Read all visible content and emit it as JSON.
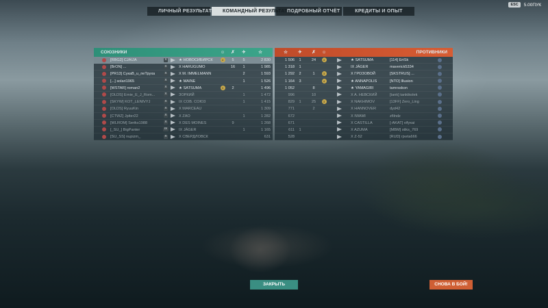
{
  "tabs": [
    {
      "label": "ЛИЧНЫЙ РЕЗУЛЬТАТ",
      "active": false
    },
    {
      "label": "КОМАНДНЫЙ РЕЗУЛЬТАТ",
      "active": true
    },
    {
      "label": "ПОДРОБНЫЙ ОТЧЁТ",
      "active": false
    },
    {
      "label": "КРЕДИТЫ И ОПЫТ",
      "active": false
    }
  ],
  "topbar": {
    "esc": "ESC",
    "version": "5.00ПУК"
  },
  "allies": {
    "title": "СОЮЗНИКИ",
    "accent": "#3ca58a",
    "rows": [
      {
        "player": "[RBG2] CJAIJA",
        "tier": "X",
        "ship": "★ НОВОСИБИРСК",
        "ace": "4",
        "kills": "5",
        "planes": "5",
        "xp": "2 830",
        "self": true
      },
      {
        "player": "[BrON] ...",
        "tier": "X",
        "ship": "X HARUGUMO",
        "ace": "",
        "kills": "16",
        "planes": "1",
        "xp": "1 985"
      },
      {
        "player": "[PR13] СукаВ_u_пеТруха",
        "tier": "X",
        "ship": "X M. IMMELMANN",
        "ace": "",
        "kills": "",
        "planes": "2",
        "xp": "1 593"
      },
      {
        "player": "[...] solari1965",
        "tier": "X",
        "ship": "★ MAINE",
        "ace": "",
        "kills": "",
        "planes": "1",
        "xp": "1 526"
      },
      {
        "player": "[WSTAR] roman2",
        "tier": "X",
        "ship": "★ SATSUMA",
        "ace": "3",
        "kills": "2",
        "planes": "",
        "xp": "1 496"
      },
      {
        "player": "[OLDS] Ernie_E_J_Rom...",
        "tier": "X",
        "ship": "ЗОРКИЙ",
        "ace": "",
        "kills": "",
        "planes": "1",
        "xp": "1 472"
      },
      {
        "player": "[SKYW] KOT_LENIVYJ",
        "tier": "X",
        "ship": "IX COB. COЮ3",
        "ace": "",
        "kills": "",
        "planes": "1",
        "xp": "1 415"
      },
      {
        "player": "[OLDS] RyuuKin",
        "tier": "X",
        "ship": "X MARCEAU",
        "ace": "",
        "kills": "",
        "planes": "",
        "xp": "1 309"
      },
      {
        "player": "[CTWZ] Jpiter22",
        "tier": "X",
        "ship": "X ZAO",
        "ace": "",
        "kills": "",
        "planes": "1",
        "xp": "1 282"
      },
      {
        "player": "[WLROM] Seriks1988",
        "tier": "X",
        "ship": "X DES MOINES",
        "ace": "",
        "kills": "9",
        "planes": "",
        "xp": "1 268"
      },
      {
        "player": "[_SU_] BigPanter",
        "tier": "IX",
        "ship": "IX JÄGER",
        "ace": "",
        "kills": "",
        "planes": "1",
        "xp": "1 165"
      },
      {
        "player": "[SU_SS] nupizm_",
        "tier": "X",
        "ship": "X СВЕРДЛОВСК",
        "ace": "",
        "kills": "",
        "planes": "",
        "xp": "631"
      }
    ]
  },
  "enemies": {
    "title": "ПРОТИВНИКИ",
    "accent": "#d75c33",
    "rows": [
      {
        "player": "[114] ErtSk",
        "ship": "★ SATSUMA",
        "xp": "1 506",
        "planes": "1",
        "kills": "24",
        "ace": "4"
      },
      {
        "player": "maverick5334",
        "ship": "IX JÄGER",
        "xp": "1 318",
        "planes": "1",
        "kills": "",
        "ace": ""
      },
      {
        "player": "[SKSTRUS] ...",
        "ship": "X ГРОЗОВОЙ",
        "xp": "1 292",
        "planes": "2",
        "kills": "1",
        "ace": "3"
      },
      {
        "player": "[NTO] Illusion",
        "ship": "★ ANNAPOLIS",
        "xp": "1 164",
        "planes": "3",
        "kills": "",
        "ace": "4"
      },
      {
        "player": "tamrsskon",
        "ship": "★ YAMAGIRI",
        "xp": "1 052",
        "planes": "",
        "kills": "8",
        "ace": ""
      },
      {
        "player": "[tank] tanktkolek",
        "ship": "X A. НЕВСКИЙ",
        "xp": "996",
        "planes": "",
        "kills": "10",
        "ace": ""
      },
      {
        "player": "[13FF] Zero_Ling",
        "ship": "X NAKHIMOV",
        "xp": "829",
        "planes": "1",
        "kills": "25",
        "ace": "3"
      },
      {
        "player": "dyd42",
        "ship": "X HANNOVER",
        "xp": "771",
        "planes": "",
        "kills": "2",
        "ace": ""
      },
      {
        "player": "zfilndz",
        "ship": "X IWAMI",
        "xp": "672",
        "planes": "",
        "kills": "",
        "ace": ""
      },
      {
        "player": "[-AKAT] vifyxai",
        "ship": "X CASTILLA",
        "xp": "671",
        "planes": "",
        "kills": "",
        "ace": ""
      },
      {
        "player": "[MBM] stiks_769",
        "ship": "X AZUMA",
        "xp": "611",
        "planes": "1",
        "kills": "",
        "ace": ""
      },
      {
        "player": "[RUD] rjxeta666",
        "ship": "X Z-52",
        "xp": "528",
        "planes": "",
        "kills": "",
        "ace": ""
      }
    ]
  },
  "buttons": {
    "close": "ЗАКРЫТЬ",
    "fight": "СНОВА В БОЙ!"
  }
}
